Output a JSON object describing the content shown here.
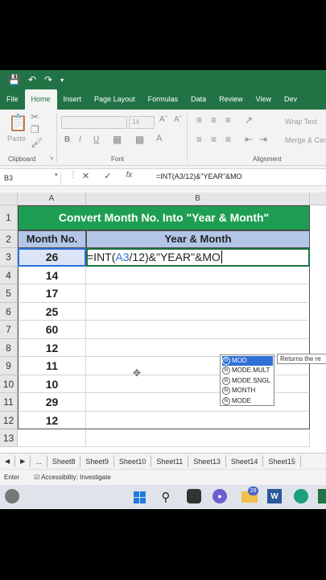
{
  "qat": {
    "save_icon": "save-icon",
    "undo_icon": "undo-icon",
    "redo_icon": "redo-icon"
  },
  "tabs": [
    "File",
    "Home",
    "Insert",
    "Page Layout",
    "Formulas",
    "Data",
    "Review",
    "View",
    "Dev"
  ],
  "ribbon": {
    "paste_label": "Paste",
    "clipboard_label": "Clipboard",
    "font_label": "Font",
    "font_size": "14",
    "bold": "B",
    "italic": "I",
    "underline": "U",
    "alignment_label": "Alignment",
    "wrap_text": "Wrap Text",
    "merge": "Merge & Cen"
  },
  "formula_bar": {
    "name_box": "B3",
    "cancel": "✕",
    "enter": "✓",
    "fx": "fx",
    "formula": "=INT(A3/12)&\"YEAR\"&MO"
  },
  "columns": [
    "A",
    "B"
  ],
  "rows": [
    "1",
    "2",
    "3",
    "4",
    "5",
    "6",
    "7",
    "8",
    "9",
    "10",
    "11",
    "12",
    "13"
  ],
  "sheet": {
    "title": "Convert Month No. Into \"Year & Month\"",
    "header_a": "Month No.",
    "header_b": "Year & Month",
    "months": [
      "26",
      "14",
      "17",
      "25",
      "60",
      "12",
      "11",
      "10",
      "29",
      "12"
    ],
    "edit_prefix": "=INT(",
    "edit_ref": "A3",
    "edit_suffix": "/12)&\"YEAR\"&MO"
  },
  "autocomplete": {
    "items": [
      "MOD",
      "MODE.MULT",
      "MODE.SNGL",
      "MONTH",
      "MODE"
    ],
    "tooltip": "Returns the re"
  },
  "sheet_tabs": [
    "...",
    "Sheet8",
    "Sheet9",
    "Sheet10",
    "Sheet11",
    "Sheet13",
    "Sheet14",
    "Sheet15"
  ],
  "status": {
    "mode": "Enter",
    "accessibility": "Accessibility: Investigate"
  },
  "taskbar": {
    "badge": "28"
  },
  "colors": {
    "excel_green": "#217346",
    "title_fill": "#1e9e52",
    "header_fill": "#b4c6e7",
    "ref_blue": "#2f6fd6"
  }
}
